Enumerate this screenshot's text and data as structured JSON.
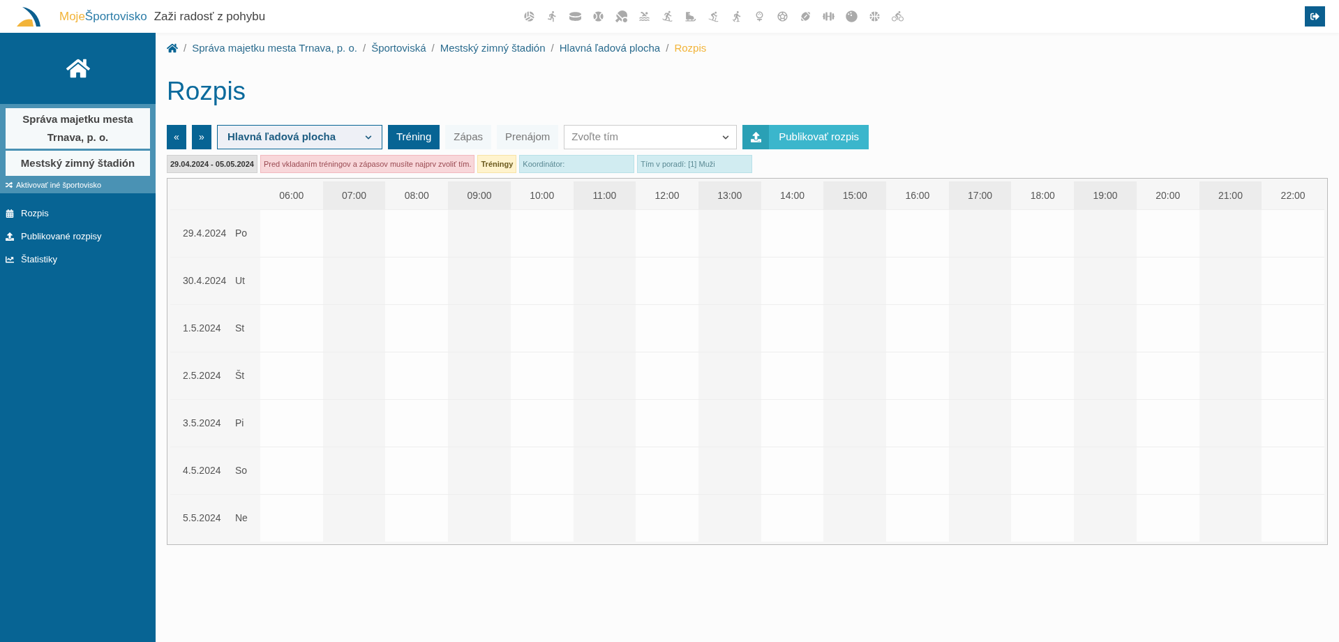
{
  "brand": {
    "name_first": "Moje",
    "name_second": "Športovisko",
    "tagline": "Zaži radosť z pohybu"
  },
  "sidebar": {
    "organization": "Správa majetku mesta Trnava, p. o.",
    "facility": "Mestský zimný štadión",
    "switch_link": "Aktivovať iné športovisko",
    "items": [
      {
        "kind": "calendar",
        "label": "Rozpis"
      },
      {
        "kind": "upload",
        "label": "Publikované rozpisy"
      },
      {
        "kind": "chart",
        "label": "Štatistiky"
      }
    ]
  },
  "breadcrumb": [
    {
      "separator": "/",
      "label": "Správa majetku mesta Trnava, p. o.",
      "selected": false
    },
    {
      "separator": "/",
      "label": "Športoviská",
      "selected": false
    },
    {
      "separator": "/",
      "label": "Mestský zimný štadión",
      "selected": false
    },
    {
      "separator": "/",
      "label": "Hlavná ľadová plocha",
      "selected": false
    },
    {
      "separator": "/",
      "label": "Rozpis",
      "selected": true
    }
  ],
  "title": "Rozpis",
  "toolbar": {
    "prev": "«",
    "next": "»",
    "area_select": "Hlavná ľadová plocha",
    "modes": [
      {
        "label": "Tréning",
        "selected": true
      },
      {
        "label": "Zápas",
        "selected": false
      },
      {
        "label": "Prenájom",
        "selected": false
      }
    ],
    "team_select": {
      "placeholder": "Zvoľte tím"
    },
    "publish": "Publikovať rozpis"
  },
  "info_tags": [
    {
      "kind": "period",
      "text": "29.04.2024 - 05.05.2024"
    },
    {
      "kind": "warning",
      "text": "Pred vkladaním tréningov a zápasov musíte najprv zvoliť tím."
    },
    {
      "kind": "type",
      "text": "Tréningy"
    },
    {
      "kind": "info",
      "text": "Koordinátor:"
    },
    {
      "kind": "info",
      "text": "Tím v poradí: [1] Muži"
    }
  ],
  "schedule": {
    "hours": [
      "06:00",
      "07:00",
      "08:00",
      "09:00",
      "10:00",
      "11:00",
      "12:00",
      "13:00",
      "14:00",
      "15:00",
      "16:00",
      "17:00",
      "18:00",
      "19:00",
      "20:00",
      "21:00",
      "22:00"
    ],
    "days": [
      {
        "date": "29.4.2024",
        "day": "Po"
      },
      {
        "date": "30.4.2024",
        "day": "Ut"
      },
      {
        "date": "1.5.2024",
        "day": "St"
      },
      {
        "date": "2.5.2024",
        "day": "Št"
      },
      {
        "date": "3.5.2024",
        "day": "Pi"
      },
      {
        "date": "4.5.2024",
        "day": "So"
      },
      {
        "date": "5.5.2024",
        "day": "Ne"
      }
    ]
  }
}
